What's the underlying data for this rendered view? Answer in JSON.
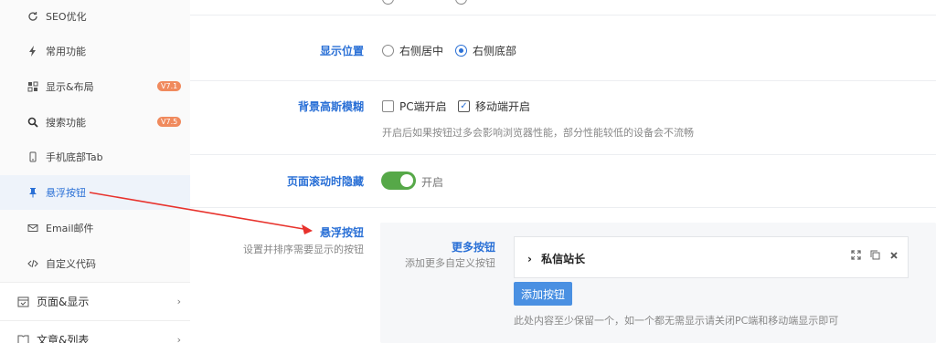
{
  "sidebar": {
    "items": [
      {
        "label": "SEO优化",
        "icon": "refresh-icon"
      },
      {
        "label": "常用功能",
        "icon": "bolt-icon"
      },
      {
        "label": "显示&布局",
        "icon": "layout-icon",
        "badge": "V7.1"
      },
      {
        "label": "搜索功能",
        "icon": "search-icon",
        "badge": "V7.5"
      },
      {
        "label": "手机底部Tab",
        "icon": "mobile-icon"
      },
      {
        "label": "悬浮按钮",
        "icon": "pin-icon"
      },
      {
        "label": "Email邮件",
        "icon": "mail-icon"
      },
      {
        "label": "自定义代码",
        "icon": "code-icon"
      }
    ],
    "groups": [
      {
        "label": "页面&显示",
        "icon": "calendar-icon"
      },
      {
        "label": "文章&列表",
        "icon": "book-icon"
      }
    ]
  },
  "settings": {
    "position": {
      "label": "显示位置",
      "options": [
        "右侧居中",
        "右侧底部"
      ],
      "selected": "右侧底部"
    },
    "blur": {
      "label": "背景高斯模糊",
      "options": [
        {
          "label": "PC端开启",
          "checked": false
        },
        {
          "label": "移动端开启",
          "checked": true
        }
      ],
      "hint": "开启后如果按钮过多会影响浏览器性能，部分性能较低的设备会不流畅"
    },
    "scroll_hide": {
      "label": "页面滚动时隐藏",
      "state_label": "开启",
      "on": true
    },
    "float_buttons": {
      "label": "悬浮按钮",
      "desc": "设置并排序需要显示的按钮",
      "more": {
        "label": "更多按钮",
        "desc": "添加更多自定义按钮",
        "items": [
          {
            "title": "私信站长"
          }
        ],
        "add_label": "添加按钮",
        "hint": "此处内容至少保留一个，如一个都无需显示请关闭PC端和移动端显示即可"
      }
    }
  },
  "colors": {
    "accent": "#2a70d6",
    "toggle_on": "#56a848",
    "badge": "#f08a5d",
    "arrow": "#e8322c"
  }
}
